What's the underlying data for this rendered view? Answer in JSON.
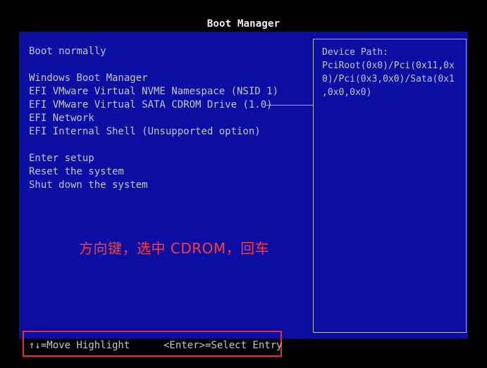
{
  "window_title": "Boot Manager",
  "menu": {
    "boot_normally": "Boot normally",
    "windows_boot_manager": "Windows Boot Manager",
    "nvme": "EFI VMware Virtual NVME Namespace (NSID 1)",
    "sata_cdrom": "EFI VMware Virtual SATA CDROM Drive (1.0)",
    "network": "EFI Network",
    "internal_shell": "EFI Internal Shell (Unsupported option)",
    "enter_setup": "Enter setup",
    "reset": "Reset the system",
    "shut_down": "Shut down the system"
  },
  "info_panel": {
    "text": "Device Path:\nPciRoot(0x0)/Pci(0x11,0x\n0)/Pci(0x3,0x0)/Sata(0x1\n,0x0,0x0)"
  },
  "annotation": "方向键，选中 CDROM，回车",
  "footer": {
    "move": "↑↓=Move Highlight",
    "select": "<Enter>=Select Entry"
  },
  "colors": {
    "panel_bg": "#0a0ea2",
    "highlight_bg": "#00a6a6",
    "annotation": "#ff3b3b",
    "footer_box": "#e0303a"
  }
}
